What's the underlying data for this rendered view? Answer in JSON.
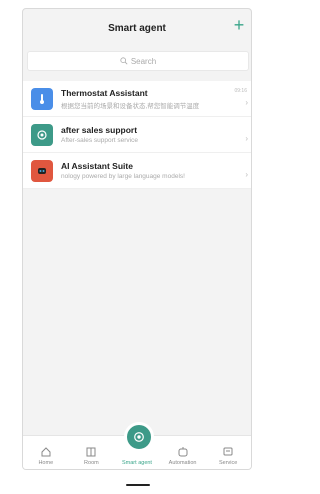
{
  "header": {
    "title": "Smart agent",
    "add_label": "+"
  },
  "search": {
    "placeholder": "Search"
  },
  "agents": [
    {
      "title": "Thermostat Assistant",
      "subtitle": "根据您当前的场景和设备状态,帮您智能调节温度",
      "time": "09:16",
      "avatar_color": "#4a8ee8",
      "icon": "thermometer-icon"
    },
    {
      "title": "after sales support",
      "subtitle": "After-sales support service",
      "time": "",
      "avatar_color": "#3d9a88",
      "icon": "openai-icon"
    },
    {
      "title": "AI Assistant Suite",
      "subtitle": "nology powered by large language models!",
      "time": "",
      "avatar_color": "#e0573f",
      "icon": "robot-icon"
    }
  ],
  "tabs": [
    {
      "label": "Home",
      "icon": "home-icon"
    },
    {
      "label": "Room",
      "icon": "room-icon"
    },
    {
      "label": "Smart agent",
      "icon": "openai-icon"
    },
    {
      "label": "Automation",
      "icon": "automation-icon"
    },
    {
      "label": "Service",
      "icon": "service-icon"
    }
  ],
  "colors": {
    "accent": "#3aa58a"
  }
}
